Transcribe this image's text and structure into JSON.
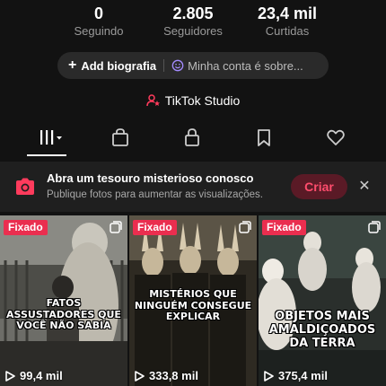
{
  "stats": [
    {
      "value": "0",
      "label": "Seguindo"
    },
    {
      "value": "2.805",
      "label": "Seguidores"
    },
    {
      "value": "23,4 mil",
      "label": "Curtidas"
    }
  ],
  "bio": {
    "add_label": "Add biografia",
    "account_label": "Minha conta é sobre..."
  },
  "studio": {
    "label": "TikTok Studio"
  },
  "tabs": [
    "videos-grid",
    "shop",
    "private",
    "saved",
    "liked"
  ],
  "banner": {
    "title": "Abra um tesouro misterioso conosco",
    "subtitle": "Publique fotos para aumentar as visualizações.",
    "button": "Criar"
  },
  "posts": [
    {
      "badge": "Fixado",
      "caption": "FATOS ASSUSTADORES QUE VOCÊ NÃO SABIA",
      "views": "99,4 mil"
    },
    {
      "badge": "Fixado",
      "caption": "MISTÉRIOS QUE NINGUÉM CONSEGUE EXPLICAR",
      "views": "333,8 mil"
    },
    {
      "badge": "Fixado",
      "caption": "OBJETOS MAIS AMALDIÇOADOS DA TERRA",
      "views": "375,4 mil"
    }
  ],
  "colors": {
    "accent": "#ea2e4f",
    "background": "#121212",
    "criar_bg": "#5a1a26",
    "criar_text": "#ff4d6d"
  }
}
